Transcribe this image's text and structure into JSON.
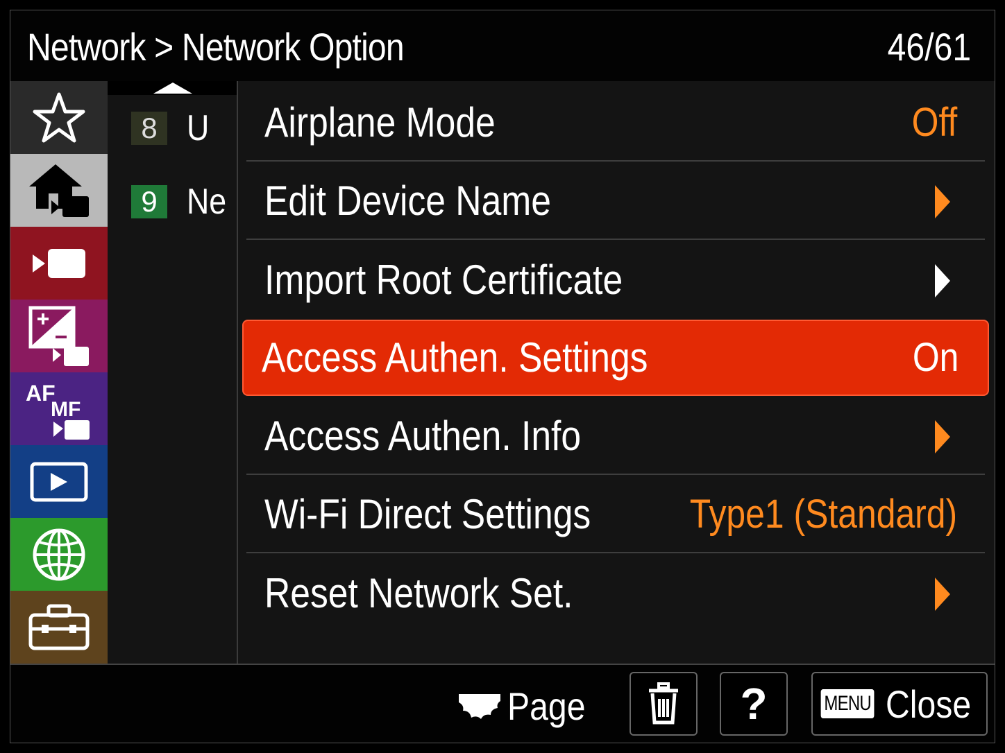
{
  "header": {
    "title": "Network > Network Option",
    "page": "46/61"
  },
  "tabs": [
    {
      "icon": "star-icon",
      "color": "#2a2a2a"
    },
    {
      "icon": "home-movie-icon",
      "color": "#b9b9b9"
    },
    {
      "icon": "movie-camera-icon",
      "color": "#8f1420"
    },
    {
      "icon": "exposure-movie-icon",
      "color": "#8a1a5f"
    },
    {
      "icon": "af-mf-movie-icon",
      "color": "#4b2383"
    },
    {
      "icon": "playback-icon",
      "color": "#133f86"
    },
    {
      "icon": "globe-network-icon",
      "color": "#2c9a2c"
    },
    {
      "icon": "toolbox-icon",
      "color": "#5e431d"
    }
  ],
  "subitems": [
    {
      "num": "8",
      "text": "U",
      "num_bg": "#2f3322",
      "num_color": "#ddd"
    },
    {
      "num": "9",
      "text": "Ne",
      "num_bg": "#1f7a38",
      "num_color": "#fff"
    }
  ],
  "items": [
    {
      "label": "Airplane Mode",
      "value": "Off",
      "type": "value"
    },
    {
      "label": "Edit Device Name",
      "value": "",
      "type": "arrow"
    },
    {
      "label": "Import Root Certificate",
      "value": "",
      "type": "arrow-white"
    },
    {
      "label": "Access Authen. Settings",
      "value": "On",
      "type": "selected"
    },
    {
      "label": "Access Authen. Info",
      "value": "",
      "type": "arrow"
    },
    {
      "label": "Wi-Fi Direct Settings",
      "value": "Type1 (Standard)",
      "type": "value"
    },
    {
      "label": "Reset Network Set.",
      "value": "",
      "type": "arrow"
    }
  ],
  "footer": {
    "page_label": "Page",
    "delete_icon": "trash-icon",
    "help_label": "?",
    "menu_badge": "MENU",
    "close_label": "Close"
  },
  "colors": {
    "accent": "#ff8a1f",
    "selected": "#e32a05"
  }
}
